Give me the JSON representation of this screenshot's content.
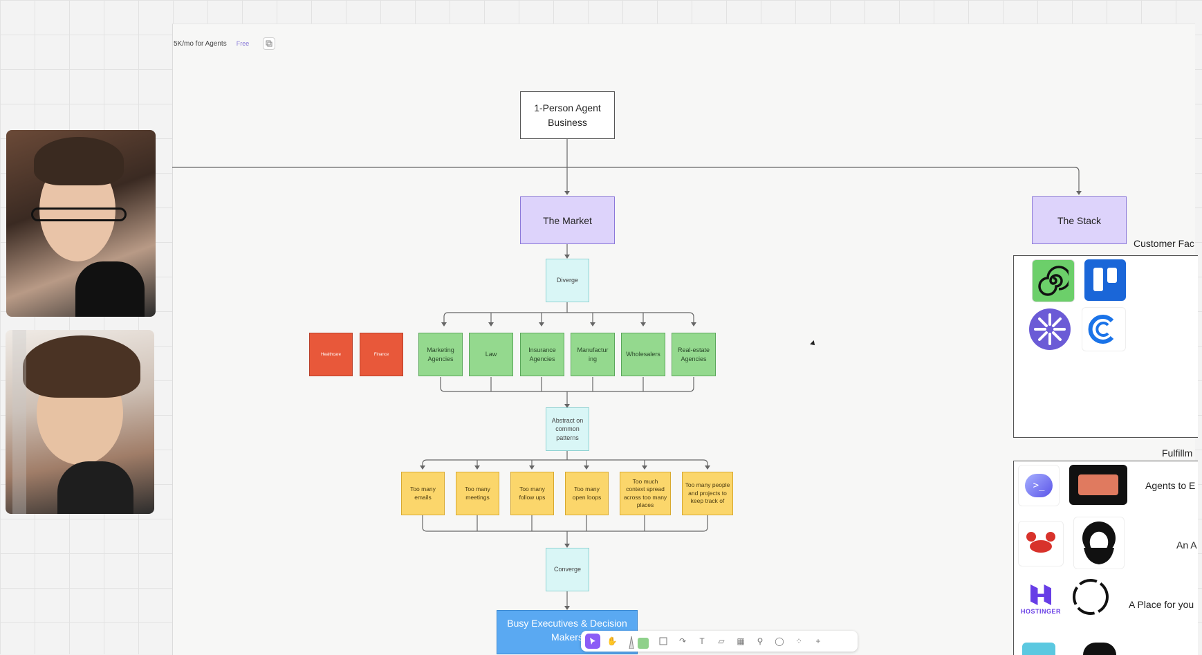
{
  "frame": {
    "title": "5K/mo for Agents",
    "badge": "Free"
  },
  "nodes": {
    "root": "1-Person Agent Business",
    "market": "The Market",
    "stack": "The Stack",
    "diverge": "Diverge",
    "industries_red": [
      "Healthcare",
      "Finance"
    ],
    "industries_green": [
      "Marketing Agencies",
      "Law",
      "Insurance Agencies",
      "Manufactur ing",
      "Wholesalers",
      "Real-estate Agencies"
    ],
    "abstract": "Abstract on common patterns",
    "problems": [
      "Too many emails",
      "Too many meetings",
      "Too many follow ups",
      "Too many open loops",
      "Too much context spread across too many places",
      "Too many people and projects to keep track of"
    ],
    "converge": "Converge",
    "target": "Busy Executives & Decision Makers"
  },
  "stack_panel": {
    "customer_label": "Customer Fac",
    "fulfillment_label": "Fulfillm",
    "rows": [
      "Agents to E",
      "An A",
      "A Place for you"
    ],
    "hostinger": "HOSTINGER"
  },
  "toolbar": {
    "tools": [
      "select-icon",
      "hand-icon",
      "pen-icon",
      "highlighter-icon",
      "shape-icon",
      "arrow-icon",
      "text-icon",
      "sticky-icon",
      "table-icon",
      "person-icon",
      "comment-icon",
      "apps-icon",
      "plus-icon"
    ]
  },
  "colors": {
    "purple": "#ddd3fb",
    "green": "#94d98e",
    "red": "#e8583a",
    "yellow": "#fbd66b",
    "cyan": "#d9f6f6",
    "blue": "#5aa9f2",
    "accent": "#8b5cf6"
  }
}
